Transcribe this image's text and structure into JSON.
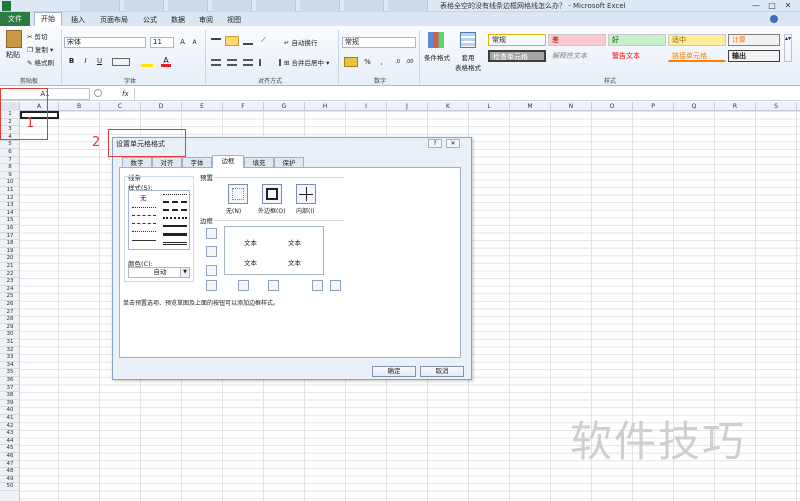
{
  "window": {
    "title": "表格全空的没有线条边框网格线怎么办？ - Microsoft Excel",
    "controls": [
      "—",
      "□",
      "✕"
    ]
  },
  "ribbon_tabs": [
    "文件",
    "开始",
    "插入",
    "页面布局",
    "公式",
    "数据",
    "审阅",
    "视图"
  ],
  "clipboard": {
    "paste": "粘贴",
    "cut": "剪切",
    "copy": "复制 ▾",
    "format_painter": "格式刷",
    "group": "剪贴板"
  },
  "font": {
    "name": "宋体",
    "size": "11",
    "group": "字体",
    "bold": "B",
    "italic": "I",
    "underline": "U"
  },
  "alignment": {
    "wrap": "自动换行",
    "merge": "合并后居中 ▾",
    "group": "对齐方式"
  },
  "number": {
    "format": "常规",
    "percent": "%",
    "comma": ",",
    "group": "数字"
  },
  "styles_group": {
    "conditional": "条件格式",
    "table": "套用",
    "table2": "表格格式",
    "group": "样式",
    "cells": [
      {
        "label": "常规",
        "bg": "#ffffff"
      },
      {
        "label": "差",
        "bg": "#ffc7ce"
      },
      {
        "label": "好",
        "bg": "#c6efce"
      },
      {
        "label": "适中",
        "bg": "#ffeb9c"
      },
      {
        "label": "计算",
        "bg": "#f2f2f2"
      },
      {
        "label": "检查单元格",
        "bg": "#a5a5a5"
      },
      {
        "label": "解释性文本",
        "bg": "#ffffff"
      },
      {
        "label": "警告文本",
        "bg": "#ffffff"
      },
      {
        "label": "链接单元格",
        "bg": "#ffffff"
      },
      {
        "label": "输出",
        "bg": "#f2f2f2"
      }
    ]
  },
  "formula_bar": {
    "name_box": "A1",
    "fx": "fx"
  },
  "columns": [
    "A",
    "B",
    "C",
    "D",
    "E",
    "F",
    "G",
    "H",
    "I",
    "J",
    "K",
    "L",
    "M",
    "N",
    "O",
    "P",
    "Q",
    "R",
    "S"
  ],
  "rows": [
    "1",
    "2",
    "3",
    "4",
    "5",
    "6",
    "7",
    "8",
    "9",
    "10",
    "11",
    "12",
    "13",
    "14",
    "15",
    "16",
    "17",
    "18",
    "19",
    "20",
    "21",
    "22",
    "23",
    "24",
    "25",
    "26",
    "27",
    "28",
    "29",
    "30",
    "31",
    "32",
    "33",
    "34",
    "35",
    "36",
    "37",
    "38",
    "39",
    "40",
    "41",
    "42",
    "43",
    "44",
    "45",
    "46",
    "47",
    "48",
    "49",
    "50"
  ],
  "annotations": {
    "one": "1",
    "two": "2"
  },
  "dialog": {
    "title": "设置单元格格式",
    "help": "?",
    "close": "✕",
    "tabs": [
      "数字",
      "对齐",
      "字体",
      "边框",
      "填充",
      "保护"
    ],
    "active_tab": "边框",
    "line_label": "线条",
    "style_label": "样式(S):",
    "none_label": "无",
    "color_label": "颜色(C):",
    "color_value": "自动",
    "presets_label": "预置",
    "preset_none": "无(N)",
    "preset_outline": "外边框(O)",
    "preset_inside": "内部(I)",
    "border_label": "边框",
    "preview_text": [
      "文本",
      "文本",
      "文本",
      "文本"
    ],
    "hint": "单击预置选项、预览草图及上面的按钮可以添加边框样式。",
    "ok": "确定",
    "cancel": "取消"
  },
  "watermark": "软件技巧"
}
